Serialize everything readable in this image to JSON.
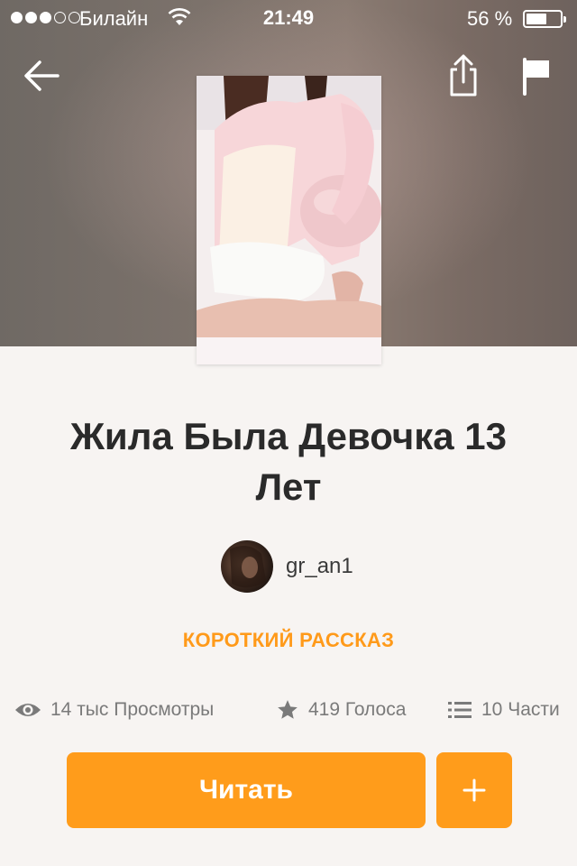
{
  "status_bar": {
    "carrier": "Билайн",
    "time": "21:49",
    "battery": "56 %",
    "signal_bars_filled": 3,
    "signal_bars_total": 5,
    "battery_level": 0.56
  },
  "nav": {
    "back_icon": "arrow-left-icon",
    "share_icon": "share-icon",
    "flag_icon": "flag-icon"
  },
  "story": {
    "title": "Жила Была Девочка 13 Лет",
    "author": "gr_an1",
    "category": "КОРОТКИЙ РАССКАЗ"
  },
  "stats": {
    "views": "14 тыс Просмотры",
    "votes": "419 Голоса",
    "parts": "10 Части"
  },
  "actions": {
    "read_label": "Читать",
    "add_label": "+"
  },
  "colors": {
    "accent": "#ff9c1b",
    "category": "#ff9a1a",
    "background": "#f7f4f2"
  }
}
